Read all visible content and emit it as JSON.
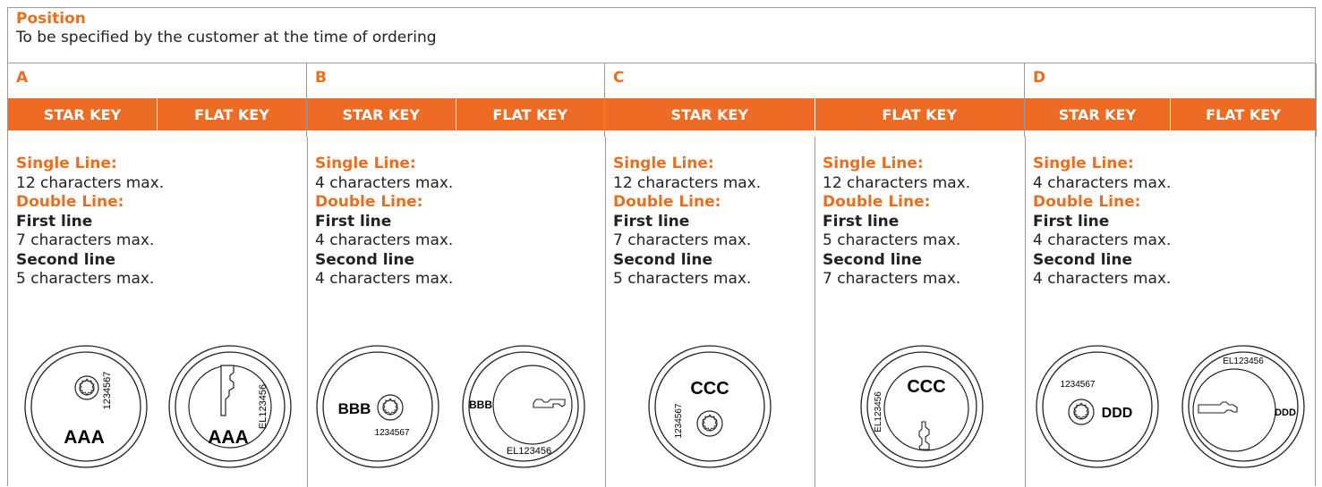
{
  "header": {
    "title": "Position",
    "subtitle": "To be specified by the customer at the time of ordering"
  },
  "key_labels": {
    "star": "STAR KEY",
    "flat": "FLAT KEY"
  },
  "positions": [
    {
      "letter": "A",
      "star": {
        "single_label": "Single Line:",
        "single": "12 characters max.",
        "double_label": "Double Line:",
        "first_label": "First line",
        "first": "7 characters max.",
        "second_label": "Second line",
        "second": "5 characters max.",
        "code": "AAA",
        "serial": "1234567"
      },
      "flat": {
        "code": "AAA",
        "serial": "EL123456"
      }
    },
    {
      "letter": "B",
      "star": {
        "single_label": "Single Line:",
        "single": "4 characters max.",
        "double_label": "Double Line:",
        "first_label": "First line",
        "first": "4 characters max.",
        "second_label": "Second line",
        "second": "4 characters max.",
        "code": "BBB",
        "serial": "1234567"
      },
      "flat": {
        "code": "BBB",
        "serial": "EL123456"
      }
    },
    {
      "letter": "C",
      "star": {
        "single_label": "Single Line:",
        "single": "12 characters max.",
        "double_label": "Double Line:",
        "first_label": "First line",
        "first": "7 characters max.",
        "second_label": "Second line",
        "second": "5 characters max.",
        "code": "CCC",
        "serial": "1234567"
      },
      "flat": {
        "single_label": "Single Line:",
        "single": "12 characters max.",
        "double_label": "Double Line:",
        "first_label": "First line",
        "first": "5 characters max.",
        "second_label": "Second line",
        "second": "7 characters max.",
        "code": "CCC",
        "serial": "EL123456"
      }
    },
    {
      "letter": "D",
      "star": {
        "single_label": "Single Line:",
        "single": "4 characters max.",
        "double_label": "Double Line:",
        "first_label": "First line",
        "first": "4 characters max.",
        "second_label": "Second line",
        "second": "4 characters max.",
        "code": "DDD",
        "serial": "1234567"
      },
      "flat": {
        "code": "DDD",
        "serial": "EL123456"
      }
    }
  ],
  "colors": {
    "accent": "#e86f22",
    "band": "#ee6b25",
    "border": "#9a9a9a"
  }
}
